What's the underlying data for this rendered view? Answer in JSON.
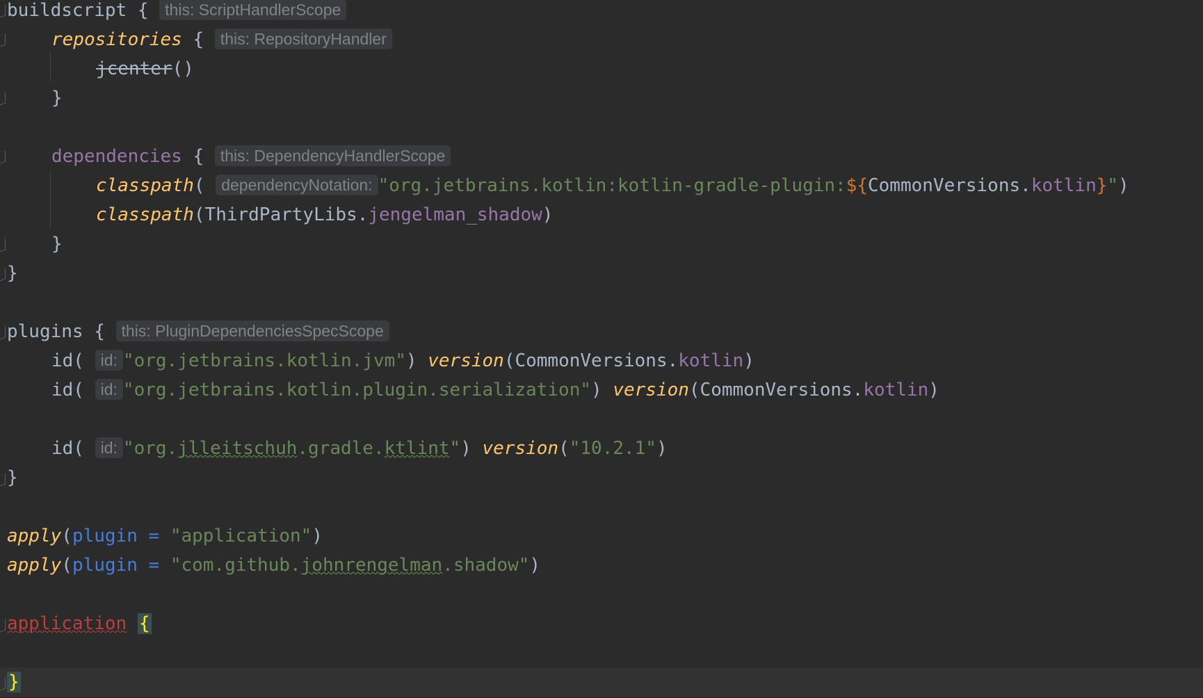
{
  "editor": {
    "language": "kotlin-gradle",
    "colors": {
      "background": "#2b2b2b",
      "text": "#a9b7c6",
      "function": "#ffc66d",
      "string": "#6a8759",
      "property": "#9876aa",
      "named_argument": "#467cda",
      "error": "#bc3f3c",
      "brace_highlight": "#ffef28"
    },
    "lines": {
      "l1": {
        "kw": "buildscript",
        "brace": " {",
        "hint": "this: ScriptHandlerScope"
      },
      "l2": {
        "kw": "repositories",
        "brace": " {",
        "hint": "this: RepositoryHandler"
      },
      "l3": {
        "fn": "jcenter",
        "rest": "()"
      },
      "l4": {
        "brace": "}"
      },
      "l6": {
        "kw": "dependencies",
        "brace": " {",
        "hint": "this: DependencyHandlerScope"
      },
      "l7": {
        "fn": "classpath",
        "open": "(",
        "hint": "dependencyNotation:",
        "str1": "\"org.jetbrains.kotlin:kotlin-gradle-plugin:",
        "tmpl_open": "${",
        "obj": "CommonVersions.",
        "prop": "kotlin",
        "tmpl_close": "}",
        "str2": "\"",
        "close": ")"
      },
      "l8": {
        "fn": "classpath",
        "open": "(ThirdPartyLibs.",
        "prop": "jengelman_shadow",
        "close": ")"
      },
      "l9": {
        "brace": "}"
      },
      "l10": {
        "brace": "}"
      },
      "l12": {
        "kw": "plugins",
        "brace": " {",
        "hint": "this: PluginDependenciesSpecScope"
      },
      "l13": {
        "fn": "id(",
        "hint": "id:",
        "str": "\"org.jetbrains.kotlin.jvm\"",
        "close": ") ",
        "ver": "version",
        "open2": "(CommonVersions.",
        "prop": "kotlin",
        "close2": ")"
      },
      "l14": {
        "fn": "id(",
        "hint": "id:",
        "str": "\"org.jetbrains.kotlin.plugin.serialization\"",
        "close": ") ",
        "ver": "version",
        "open2": "(CommonVersions.",
        "prop": "kotlin",
        "close2": ")"
      },
      "l16": {
        "fn": "id(",
        "hint": "id:",
        "str_a": "\"org.",
        "str_b": "jlleitschuh",
        "str_c": ".gradle.",
        "str_d": "ktlint",
        "str_e": "\"",
        "close": ") ",
        "ver": "version",
        "open2": "(",
        "str2": "\"10.2.1\"",
        "close2": ")"
      },
      "l17": {
        "brace": "}"
      },
      "l19": {
        "fn": "apply",
        "open": "(",
        "arg": "plugin",
        "eq": " = ",
        "str": "\"application\"",
        "close": ")"
      },
      "l20": {
        "fn": "apply",
        "open": "(",
        "arg": "plugin",
        "eq": " = ",
        "str_a": "\"com.github.",
        "str_b": "johnrengelman",
        "str_c": ".shadow\"",
        "close": ")"
      },
      "l22": {
        "kw": "application",
        "space": " ",
        "brace": "{"
      },
      "l24": {
        "brace": "}"
      }
    }
  }
}
